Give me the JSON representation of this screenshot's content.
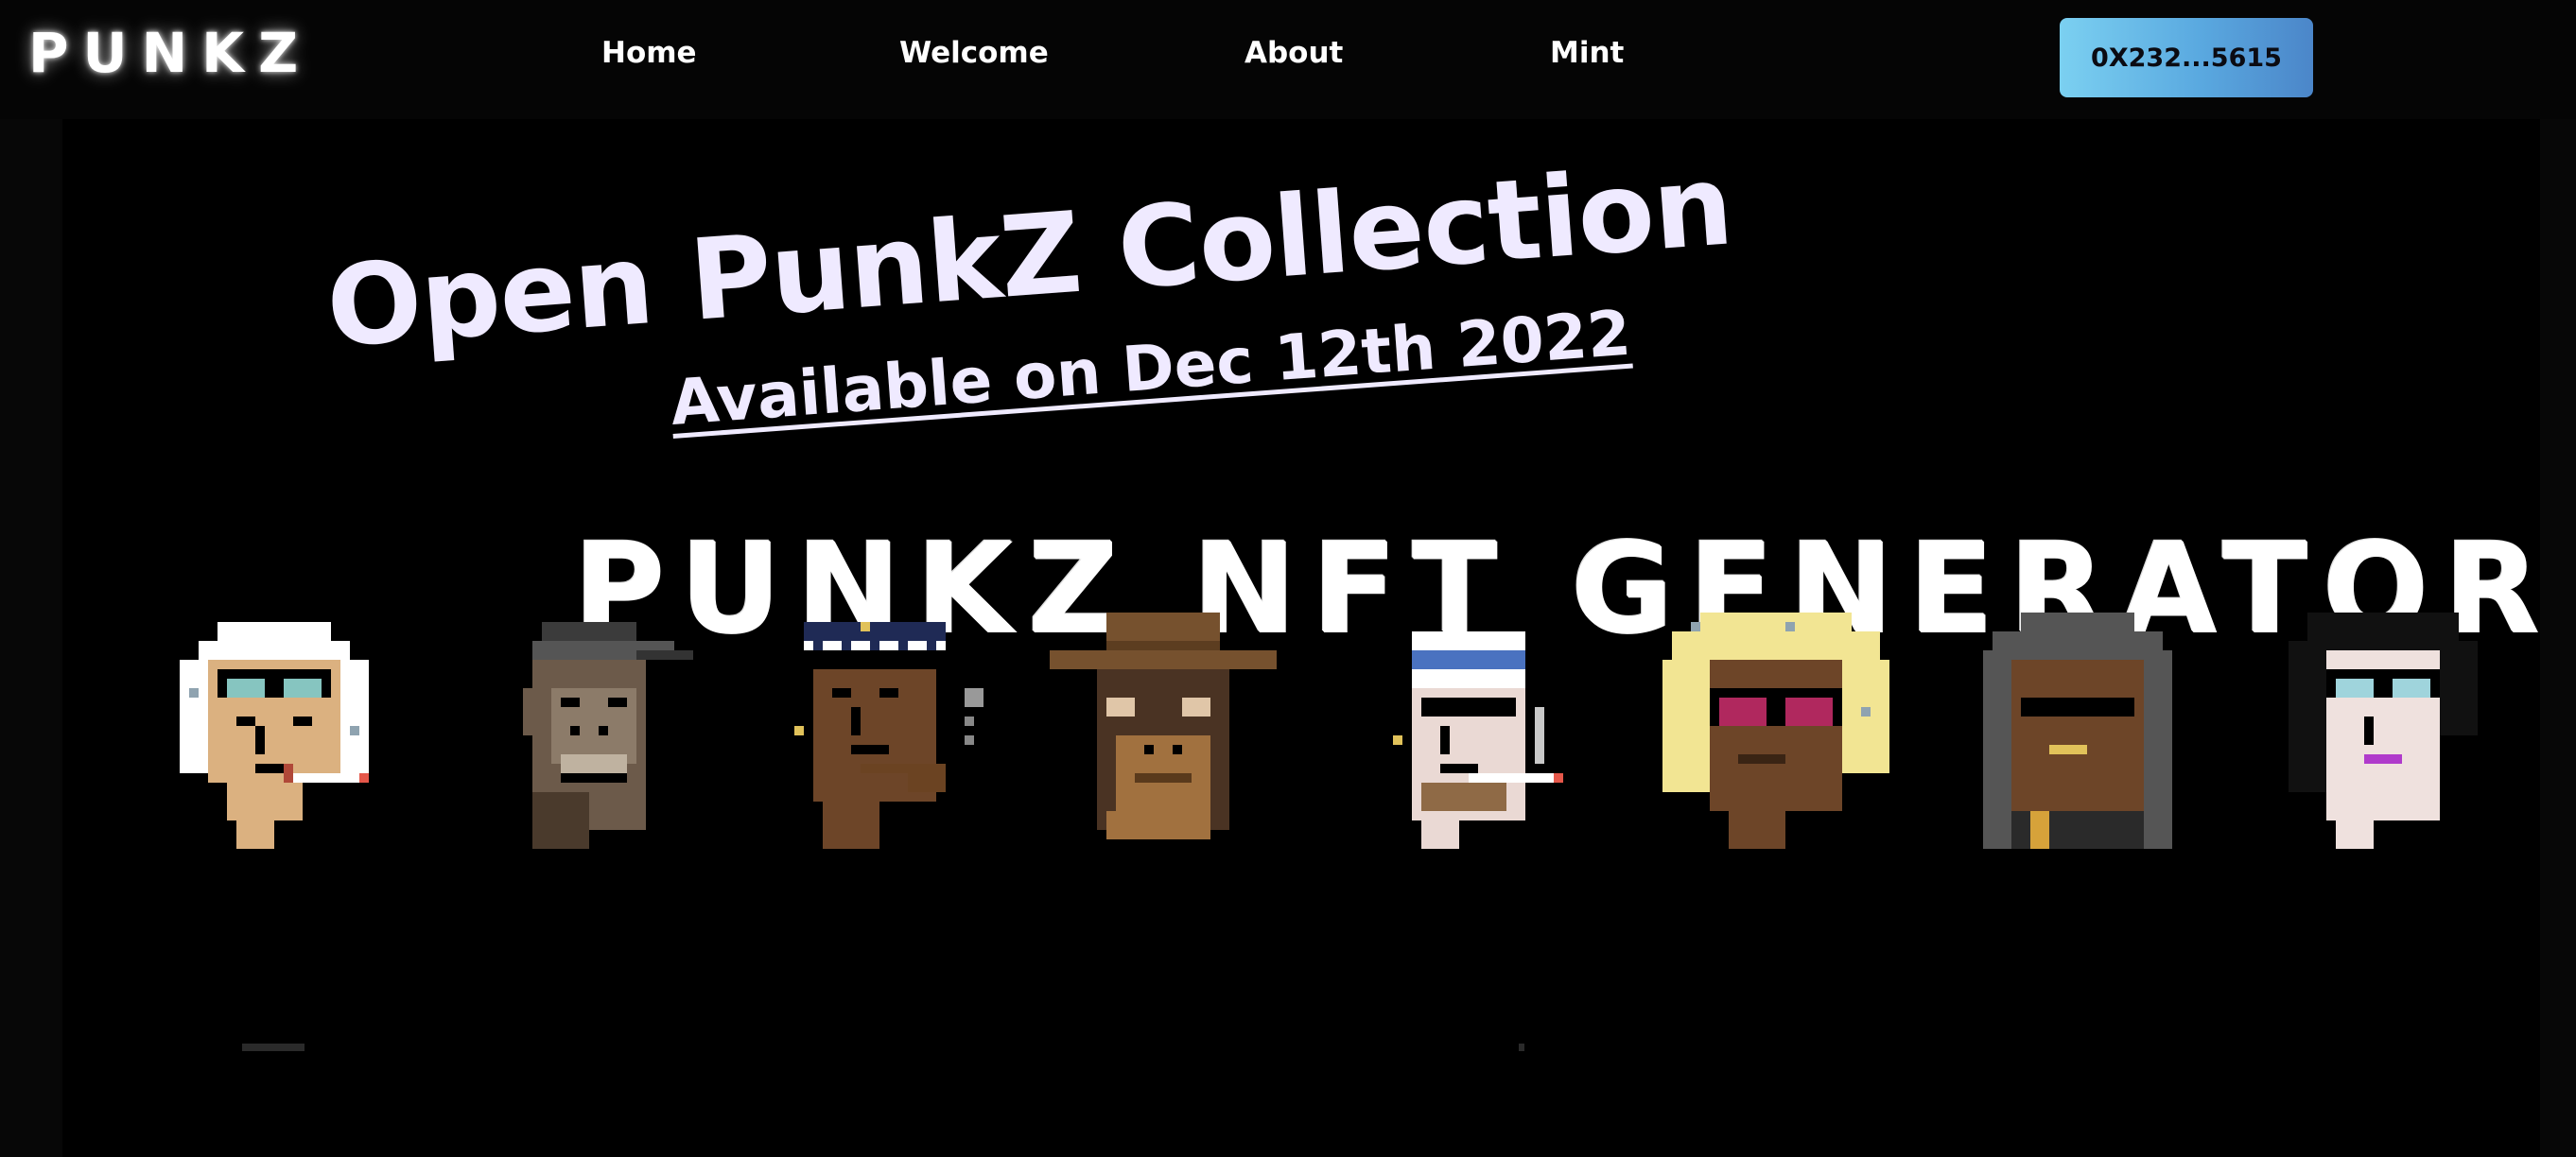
{
  "brand": {
    "logo_text": "PUNKZ"
  },
  "nav": {
    "items": [
      {
        "label": "Home"
      },
      {
        "label": "Welcome"
      },
      {
        "label": "About"
      },
      {
        "label": "Mint"
      }
    ],
    "wallet_button_label": "0X232...5615"
  },
  "hero": {
    "headline": "Open PunkZ Collection",
    "subline": "Available on Dec 12th 2022",
    "generator_title": "PUNKZ NFT GENERATOR"
  },
  "punks": [
    {
      "name": "punk-white-hair-goggles-cigarette"
    },
    {
      "name": "punk-ape-cap"
    },
    {
      "name": "punk-police-cap-pipe"
    },
    {
      "name": "punk-cowboy-hat-ape"
    },
    {
      "name": "punk-headband-sunglasses-cigarette"
    },
    {
      "name": "punk-blonde-wild-hair-glasses"
    },
    {
      "name": "punk-hoodie-sunglasses"
    },
    {
      "name": "punk-dark-hair-glasses-lipstick"
    }
  ],
  "colors": {
    "background": "#000000",
    "text": "#ffffff",
    "headline": "#efeaff",
    "wallet_gradient_start": "#7bd0f1",
    "wallet_gradient_end": "#4b86c9"
  }
}
